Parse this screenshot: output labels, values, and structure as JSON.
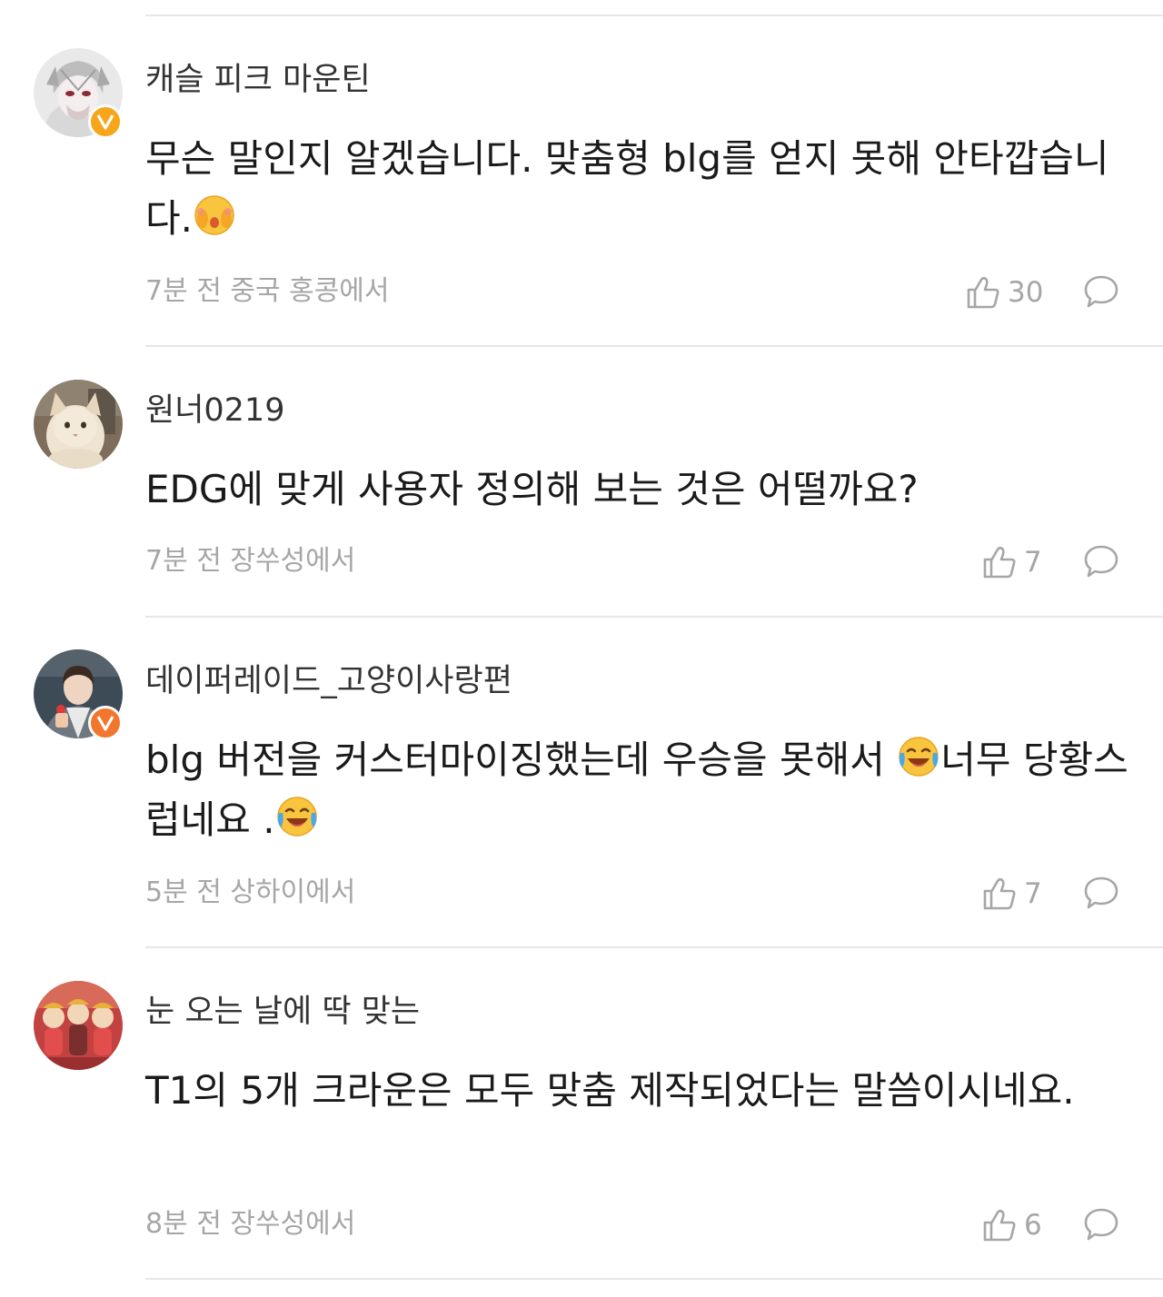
{
  "comments": [
    {
      "username": "캐슬 피크 마운틴",
      "text_parts": [
        "무슨 말인지 알겠습니다. 맞춤형 blg를 얻지 못해 안타깝습니다."
      ],
      "emoji": [
        "shy-face-emoji"
      ],
      "meta": "7분 전 중국 홍콩에서",
      "likes": "30",
      "verified": true
    },
    {
      "username": "원너0219",
      "text_parts": [
        "EDG에 맞게 사용자 정의해 보는 것은 어떨까요?"
      ],
      "meta": "7분 전 장쑤성에서",
      "likes": "7",
      "verified": false
    },
    {
      "username": "데이퍼레이드_고양이사랑편",
      "text_parts": [
        "blg 버전을 커스터마이징했는데 우승을 못해서 ",
        "너무 당황스럽네요 ."
      ],
      "emoji": [
        "laughing-crying-emoji",
        "laughing-crying-emoji"
      ],
      "meta": "5분 전 상하이에서",
      "likes": "7",
      "verified": true
    },
    {
      "username": "눈 오는 날에 딱 맞는",
      "text_parts": [
        "T1의 5개 크라운은 모두 맞춤 제작되었다는 말씀이시네요."
      ],
      "meta": "8분 전 장쑤성에서",
      "likes": "6",
      "verified": false
    }
  ],
  "icons": {
    "like": "thumbs-up-icon",
    "reply": "speech-bubble-icon",
    "verified": "verified-v-badge"
  },
  "colors": {
    "verified_badge_yellow": "#f7a61c",
    "verified_badge_orange": "#f2762d",
    "meta_gray": "#a6a6a6",
    "divider": "#e6e6e6"
  }
}
